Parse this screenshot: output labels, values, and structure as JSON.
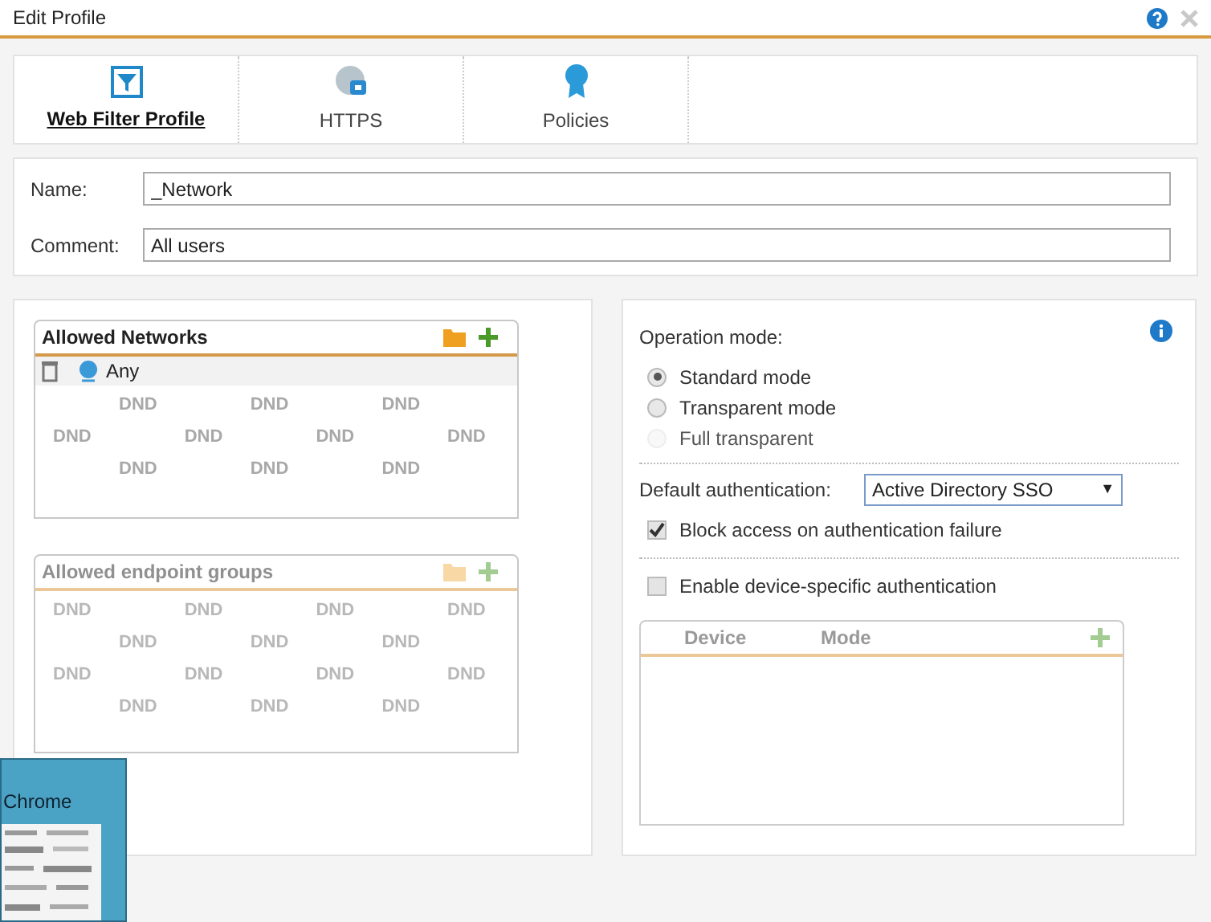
{
  "window": {
    "title": "Edit Profile"
  },
  "tabs": [
    {
      "label": "Web Filter Profile",
      "selected": true
    },
    {
      "label": "HTTPS",
      "selected": false
    },
    {
      "label": "Policies",
      "selected": false
    }
  ],
  "form": {
    "name": {
      "label": "Name:",
      "value": "_Network"
    },
    "comment": {
      "label": "Comment:",
      "value": "All users"
    }
  },
  "allowed_networks": {
    "title": "Allowed Networks",
    "disabled": false,
    "items": [
      {
        "label": "Any"
      }
    ],
    "drop_hints": [
      [
        "DND",
        "DND",
        "DND"
      ],
      [
        "DND",
        "DND",
        "DND",
        "DND"
      ],
      [
        "DND",
        "DND",
        "DND"
      ]
    ]
  },
  "allowed_endpoint_groups": {
    "title": "Allowed endpoint groups",
    "disabled": true,
    "drop_hints": [
      [
        "DND",
        "DND",
        "DND",
        "DND"
      ],
      [
        "DND",
        "DND",
        "DND"
      ],
      [
        "DND",
        "DND",
        "DND",
        "DND"
      ],
      [
        "DND",
        "DND",
        "DND"
      ]
    ]
  },
  "operation_mode": {
    "label": "Operation mode:",
    "options": [
      {
        "label": "Standard mode",
        "selected": true,
        "disabled": false
      },
      {
        "label": "Transparent mode",
        "selected": false,
        "disabled": false
      },
      {
        "label": "Full transparent",
        "selected": false,
        "disabled": true
      }
    ]
  },
  "default_authentication": {
    "label": "Default authentication:",
    "value": "Active Directory SSO",
    "arrow": "▼"
  },
  "block_access": {
    "label": "Block access on authentication failure",
    "checked": true
  },
  "device_specific": {
    "label": "Enable device-specific authentication",
    "checked": false
  },
  "device_table": {
    "columns": [
      "Device",
      "Mode"
    ],
    "disabled": true
  },
  "taskbar_preview": {
    "title": "Chrome"
  }
}
